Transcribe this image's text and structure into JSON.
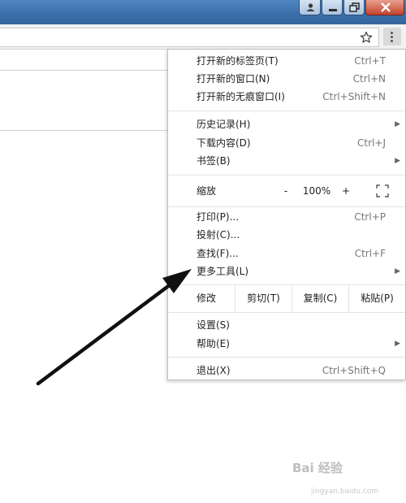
{
  "menu": {
    "new_tab": {
      "label": "打开新的标签页(T)",
      "shortcut": "Ctrl+T"
    },
    "new_window": {
      "label": "打开新的窗口(N)",
      "shortcut": "Ctrl+N"
    },
    "incognito": {
      "label": "打开新的无痕窗口(I)",
      "shortcut": "Ctrl+Shift+N"
    },
    "history": {
      "label": "历史记录(H)"
    },
    "downloads": {
      "label": "下载内容(D)",
      "shortcut": "Ctrl+J"
    },
    "bookmarks": {
      "label": "书签(B)"
    },
    "zoom": {
      "label": "缩放",
      "minus": "-",
      "value": "100%",
      "plus": "+"
    },
    "print": {
      "label": "打印(P)...",
      "shortcut": "Ctrl+P"
    },
    "cast": {
      "label": "投射(C)..."
    },
    "find": {
      "label": "查找(F)...",
      "shortcut": "Ctrl+F"
    },
    "more_tools": {
      "label": "更多工具(L)"
    },
    "edit": {
      "label": "修改",
      "cut": "剪切(T)",
      "copy": "复制(C)",
      "paste": "粘贴(P)"
    },
    "settings": {
      "label": "设置(S)"
    },
    "help": {
      "label": "帮助(E)"
    },
    "exit": {
      "label": "退出(X)",
      "shortcut": "Ctrl+Shift+Q"
    }
  },
  "submenu_arrow": "▶",
  "watermark": {
    "text": "Bai 经验",
    "sub": "jingyan.baidu.com"
  },
  "colors": {
    "titlebar": "#3a6ea8",
    "close_button": "#c4432d",
    "annotation_arrow": "#111111"
  }
}
